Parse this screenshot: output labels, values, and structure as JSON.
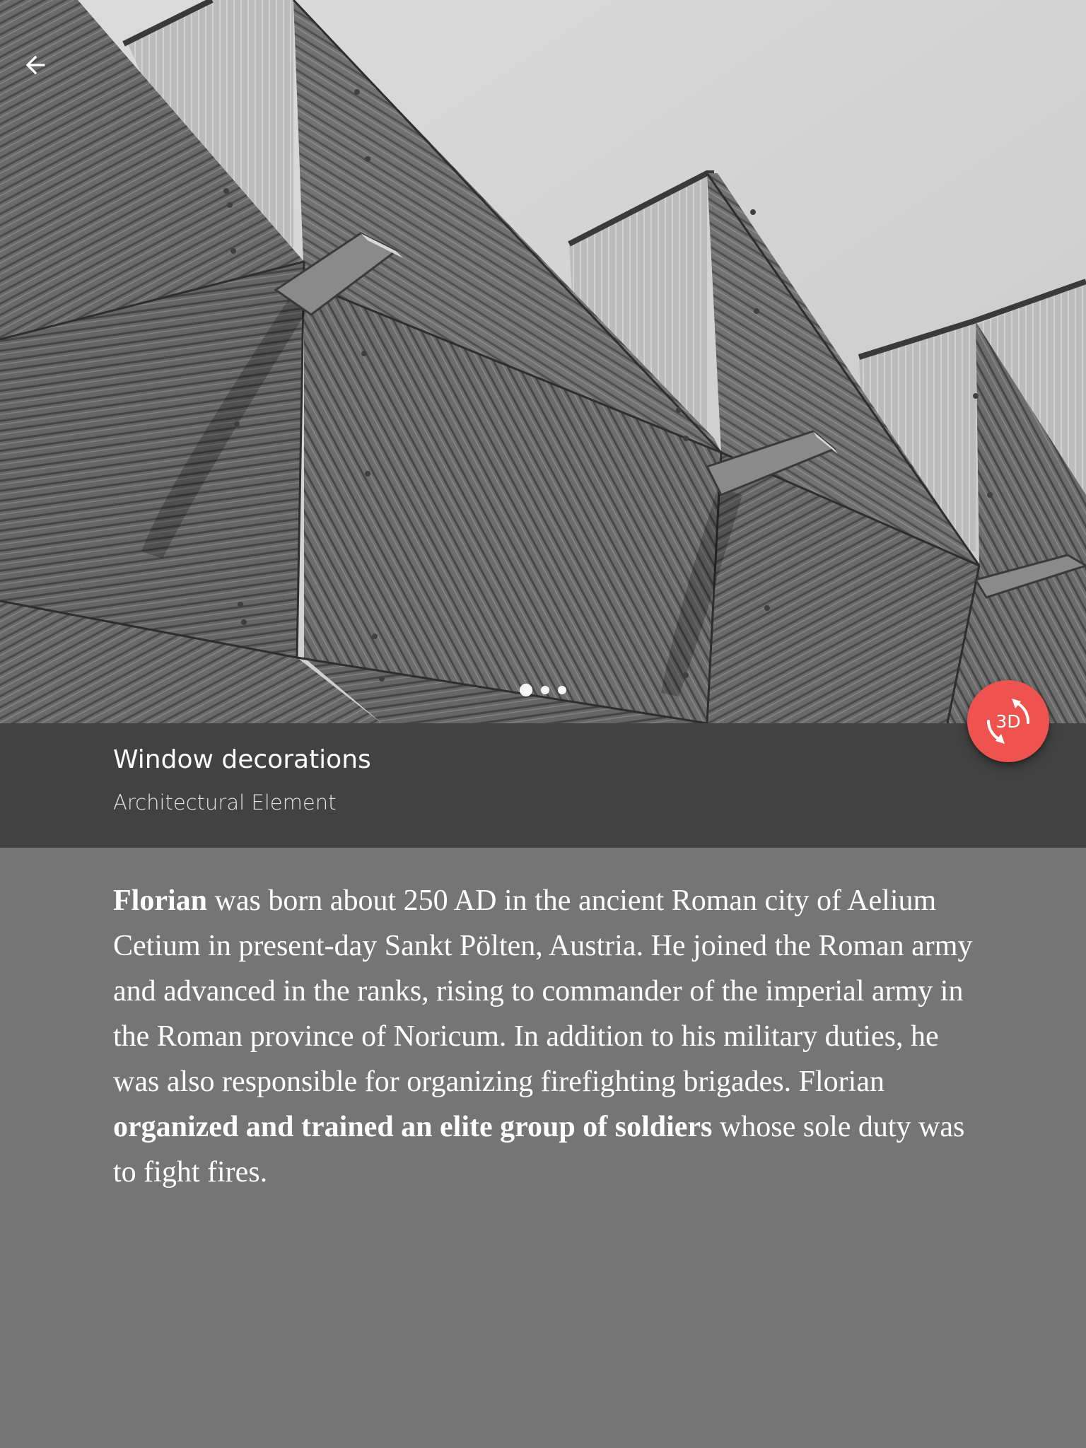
{
  "header": {
    "back_icon": "arrow-back-icon"
  },
  "hero": {
    "image_description": "black-and-white architectural facade",
    "pager": {
      "count": 3,
      "active_index": 0
    }
  },
  "info": {
    "title": "Window decorations",
    "subtitle": "Architectural Element"
  },
  "fab": {
    "label": "3D",
    "icon": "3d-rotation-icon",
    "color": "#ef5350"
  },
  "body": {
    "segments": [
      {
        "text": "Florian",
        "bold": true
      },
      {
        "text": " was born about 250 AD in the ancient Roman city of Aelium Cetium in present-day Sankt Pölten, Austria. He joined the Roman army and advanced in the ranks, rising to commander of the imperial army in the Roman province of Noricum. In addition to his military duties, he was also responsible for organizing firefighting brigades. Florian ",
        "bold": false
      },
      {
        "text": "organized and trained an elite group of soldiers",
        "bold": true
      },
      {
        "text": " whose sole duty was to fight fires.",
        "bold": false
      }
    ]
  },
  "colors": {
    "info_bar": "#424242",
    "page_background": "#757575",
    "accent": "#ef5350"
  }
}
